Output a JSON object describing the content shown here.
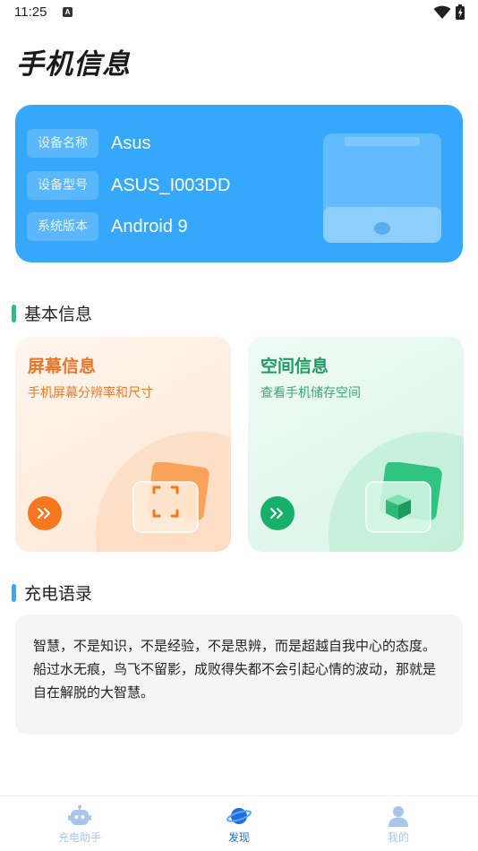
{
  "status_bar": {
    "time": "11:25",
    "notification_letter": "A"
  },
  "page_title": "手机信息",
  "device": {
    "rows": [
      {
        "label": "设备名称",
        "value": "Asus"
      },
      {
        "label": "设备型号",
        "value": "ASUS_I003DD"
      },
      {
        "label": "系统版本",
        "value": "Android 9"
      }
    ]
  },
  "basic_section": {
    "title": "基本信息",
    "cards": [
      {
        "title": "屏幕信息",
        "subtitle": "手机屏幕分辨率和尺寸"
      },
      {
        "title": "空间信息",
        "subtitle": "查看手机储存空间"
      }
    ]
  },
  "quote_section": {
    "title": "充电语录",
    "text": "智慧，不是知识，不是经验，不是思辨，而是超越自我中心的态度。船过水无痕，鸟飞不留影，成败得失都不会引起心情的波动，那就是自在解脱的大智慧。"
  },
  "bottom_nav": {
    "items": [
      {
        "label": "充电助手",
        "icon": "robot-icon",
        "active": false
      },
      {
        "label": "发现",
        "icon": "planet-icon",
        "active": true
      },
      {
        "label": "我的",
        "icon": "person-icon",
        "active": false
      }
    ]
  },
  "colors": {
    "accent_blue": "#36a8fb",
    "orange": "#f7781f",
    "green": "#17b06b",
    "nav_active": "#1f6fe0",
    "nav_inactive": "#a9c6ea"
  }
}
